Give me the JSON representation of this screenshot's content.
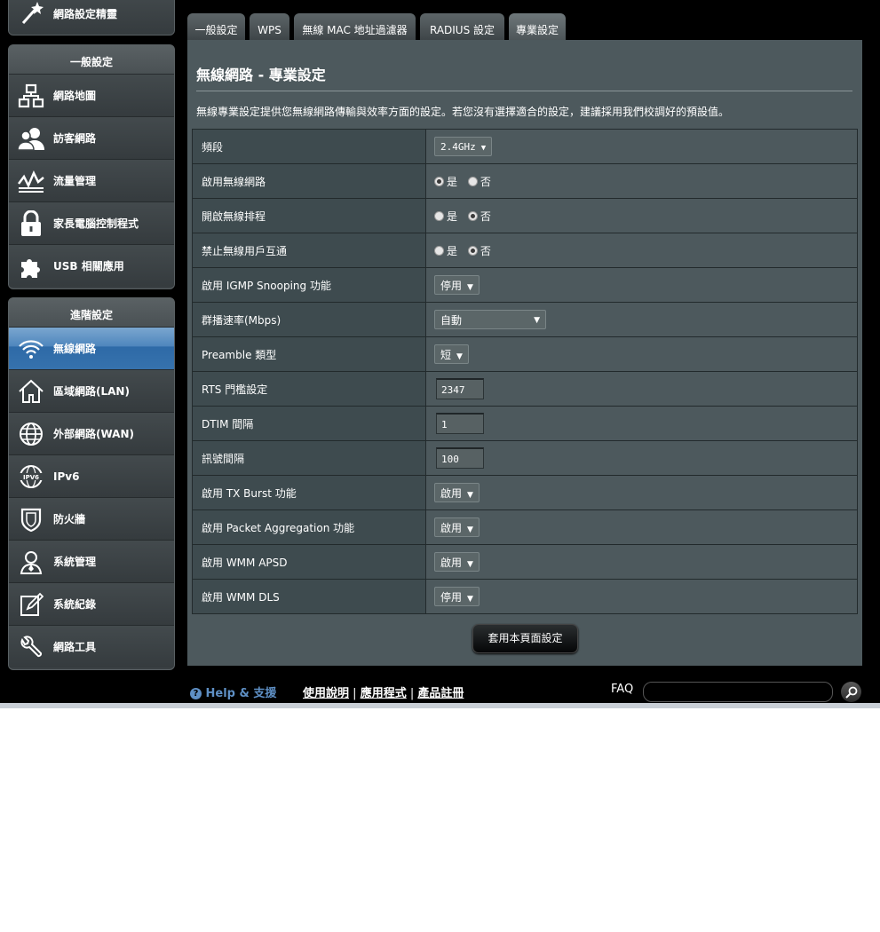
{
  "sidebar": {
    "top_item": "網路設定精靈",
    "general_header": "一般設定",
    "general_items": [
      "網路地圖",
      "訪客網路",
      "流量管理",
      "家長電腦控制程式",
      "USB 相關應用"
    ],
    "advanced_header": "進階設定",
    "advanced_items": [
      "無線網路",
      "區域網路(LAN)",
      "外部網路(WAN)",
      "IPv6",
      "防火牆",
      "系統管理",
      "系統紀錄",
      "網路工具"
    ],
    "active_item": "無線網路"
  },
  "tabs": [
    "一般設定",
    "WPS",
    "無線 MAC 地址過濾器",
    "RADIUS 設定",
    "專業設定"
  ],
  "active_tab": "專業設定",
  "panel": {
    "title": "無線網路 - 專業設定",
    "description": "無線專業設定提供您無線網路傳輸與效率方面的設定。若您沒有選擇適合的設定，建議採用我們校調好的預設值。"
  },
  "settings": [
    {
      "label": "頻段",
      "type": "select",
      "value": "2.4GHz"
    },
    {
      "label": "啟用無線網路",
      "type": "radio",
      "yes": "是",
      "no": "否",
      "selected": "yes"
    },
    {
      "label": "開啟無線排程",
      "type": "radio",
      "yes": "是",
      "no": "否",
      "selected": "no"
    },
    {
      "label": "禁止無線用戶互通",
      "type": "radio",
      "yes": "是",
      "no": "否",
      "selected": "no"
    },
    {
      "label": "啟用 IGMP Snooping 功能",
      "type": "select",
      "value": "停用"
    },
    {
      "label": "群播速率(Mbps)",
      "type": "select",
      "value": "自動"
    },
    {
      "label": "Preamble 類型",
      "type": "select",
      "value": "短"
    },
    {
      "label": "RTS 門檻設定",
      "type": "text",
      "value": "2347"
    },
    {
      "label": "DTIM 間隔",
      "type": "text",
      "value": "1"
    },
    {
      "label": "訊號間隔",
      "type": "text",
      "value": "100"
    },
    {
      "label": "啟用 TX Burst 功能",
      "type": "select",
      "value": "啟用"
    },
    {
      "label": "啟用 Packet Aggregation 功能",
      "type": "select",
      "value": "啟用"
    },
    {
      "label": "啟用 WMM APSD",
      "type": "select",
      "value": "啟用"
    },
    {
      "label": "啟用 WMM DLS",
      "type": "select",
      "value": "停用"
    }
  ],
  "apply_button": "套用本頁面設定",
  "footer": {
    "help": "Help & 支援",
    "links": [
      "使用說明",
      "應用程式",
      "產品註冊"
    ],
    "separator": "|",
    "faq": "FAQ"
  },
  "colors": {
    "panel_bg": "#4d595d",
    "label_bg": "#3e4b4f",
    "active_nav": "#3672ad",
    "help_blue": "#5e8fc4"
  }
}
